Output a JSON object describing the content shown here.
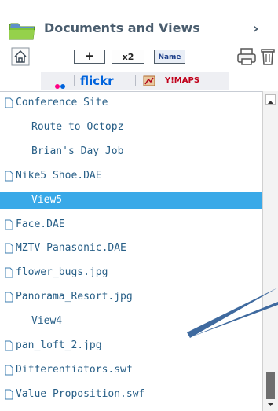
{
  "header": {
    "title": "Documents and Views",
    "chevron": "›"
  },
  "toolbar": {
    "add_label": "+",
    "x2_label": "x2",
    "name_label": "Name"
  },
  "services": {
    "flickr_label": "flickr",
    "maps_label": "Y!MAPS",
    "colors": {
      "flickr_blue": "#0063dc",
      "flickr_pink": "#ff0084",
      "maps_red": "#c0001a"
    }
  },
  "list": {
    "selected_color": "#39a9e8",
    "items": [
      {
        "label": "Conference Site",
        "kind": "file",
        "selected": false
      },
      {
        "label": "Route to Octopz",
        "kind": "view",
        "selected": false
      },
      {
        "label": "Brian's Day Job",
        "kind": "view",
        "selected": false
      },
      {
        "label": "Nike5 Shoe.DAE",
        "kind": "file",
        "selected": false
      },
      {
        "label": "View5",
        "kind": "view",
        "selected": true
      },
      {
        "label": "Face.DAE",
        "kind": "file",
        "selected": false
      },
      {
        "label": "MZTV Panasonic.DAE",
        "kind": "file",
        "selected": false
      },
      {
        "label": "flower_bugs.jpg",
        "kind": "file",
        "selected": false
      },
      {
        "label": "Panorama_Resort.jpg",
        "kind": "file",
        "selected": false
      },
      {
        "label": "View4",
        "kind": "view",
        "selected": false
      },
      {
        "label": "pan_loft_2.jpg",
        "kind": "file",
        "selected": false
      },
      {
        "label": "Differentiators.swf",
        "kind": "file",
        "selected": false
      },
      {
        "label": "Value Proposition.swf",
        "kind": "file",
        "selected": false
      }
    ]
  }
}
